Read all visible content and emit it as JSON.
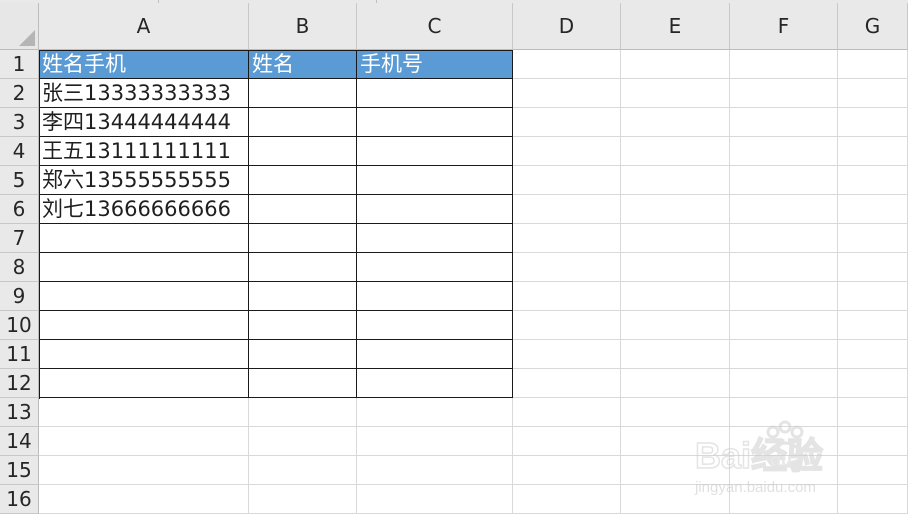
{
  "columns": [
    "A",
    "B",
    "C",
    "D",
    "E",
    "F",
    "G"
  ],
  "rows": [
    "1",
    "2",
    "3",
    "4",
    "5",
    "6",
    "7",
    "8",
    "9",
    "10",
    "11",
    "12",
    "13",
    "14",
    "15",
    "16"
  ],
  "cells": {
    "A1": "姓名手机",
    "B1": "姓名",
    "C1": "手机号",
    "A2": "张三13333333333",
    "A3": "李四13444444444",
    "A4": "王五13111111111",
    "A5": "郑六13555555555",
    "A6": "刘七13666666666"
  },
  "watermark": {
    "brand": "Bai经验",
    "du": "du",
    "url": "jingyan.baidu.com"
  },
  "colors": {
    "header_fill": "#5b9bd5",
    "header_text": "#ffffff",
    "grid": "#d9d9d9",
    "table_border": "#1a1a1a"
  }
}
